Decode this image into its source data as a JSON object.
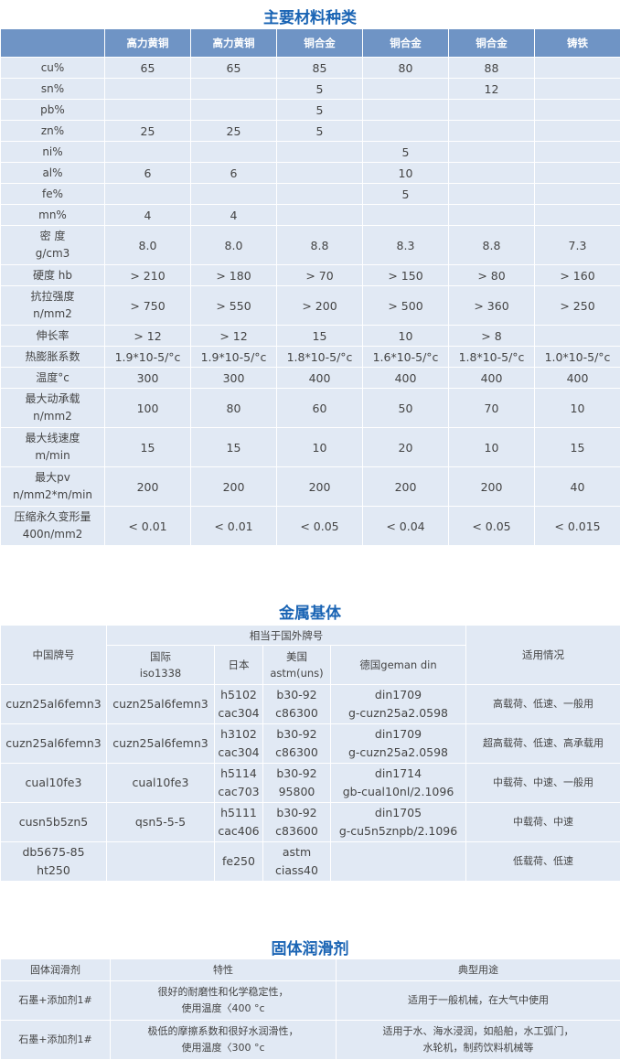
{
  "section1": {
    "title": "主要材料种类",
    "columns": [
      "",
      "高力黄铜",
      "高力黄铜",
      "铜合金",
      "铜合金",
      "铜合金",
      "铸铁"
    ],
    "rows": [
      {
        "label": [
          "cu%"
        ],
        "values": [
          "65",
          "65",
          "85",
          "80",
          "88",
          ""
        ]
      },
      {
        "label": [
          "sn%"
        ],
        "values": [
          "",
          "",
          "5",
          "",
          "12",
          ""
        ]
      },
      {
        "label": [
          "pb%"
        ],
        "values": [
          "",
          "",
          "5",
          "",
          "",
          ""
        ]
      },
      {
        "label": [
          "zn%"
        ],
        "values": [
          "25",
          "25",
          "5",
          "",
          "",
          ""
        ]
      },
      {
        "label": [
          "ni%"
        ],
        "values": [
          "",
          "",
          "",
          "5",
          "",
          ""
        ]
      },
      {
        "label": [
          "al%"
        ],
        "values": [
          "6",
          "6",
          "",
          "10",
          "",
          ""
        ]
      },
      {
        "label": [
          "fe%"
        ],
        "values": [
          "",
          "",
          "",
          "5",
          "",
          ""
        ]
      },
      {
        "label": [
          "mn%"
        ],
        "values": [
          "4",
          "4",
          "",
          "",
          "",
          ""
        ]
      },
      {
        "label": [
          "密 度",
          "g/cm3"
        ],
        "values": [
          "8.0",
          "8.0",
          "8.8",
          "8.3",
          "8.8",
          "7.3"
        ]
      },
      {
        "label": [
          "硬度 hb"
        ],
        "values": [
          "> 210",
          "> 180",
          "> 70",
          "> 150",
          "> 80",
          "> 160"
        ]
      },
      {
        "label": [
          "抗拉强度",
          "n/mm2"
        ],
        "values": [
          "> 750",
          "> 550",
          "> 200",
          "> 500",
          "> 360",
          "> 250"
        ]
      },
      {
        "label": [
          "伸长率"
        ],
        "values": [
          "> 12",
          "> 12",
          "15",
          "10",
          "> 8",
          ""
        ]
      },
      {
        "label": [
          "热膨胀系数"
        ],
        "values": [
          "1.9*10-5/°c",
          "1.9*10-5/°c",
          "1.8*10-5/°c",
          "1.6*10-5/°c",
          "1.8*10-5/°c",
          "1.0*10-5/°c"
        ]
      },
      {
        "label": [
          "温度°c"
        ],
        "values": [
          "300",
          "300",
          "400",
          "400",
          "400",
          "400"
        ]
      },
      {
        "label": [
          "最大动承载",
          "n/mm2"
        ],
        "values": [
          "100",
          "80",
          "60",
          "50",
          "70",
          "10"
        ]
      },
      {
        "label": [
          "最大线速度",
          "m/min"
        ],
        "values": [
          "15",
          "15",
          "10",
          "20",
          "10",
          "15"
        ]
      },
      {
        "label": [
          "最大pv",
          "n/mm2*m/min"
        ],
        "values": [
          "200",
          "200",
          "200",
          "200",
          "200",
          "40"
        ]
      },
      {
        "label": [
          "压缩永久变形量",
          "400n/mm2"
        ],
        "values": [
          "< 0.01",
          "< 0.01",
          "< 0.05",
          "< 0.04",
          "< 0.05",
          "< 0.015"
        ]
      }
    ]
  },
  "section2": {
    "title": "金属基体",
    "header": {
      "china": "中国牌号",
      "foreign": "相当于国外牌号",
      "usage": "适用情况",
      "intl": [
        "国际",
        "iso1338"
      ],
      "japan": [
        "日本"
      ],
      "usa": [
        "美国",
        "astm(uns)"
      ],
      "germany": [
        "德国geman din"
      ]
    },
    "rows": [
      {
        "china": [
          "cuzn25al6femn3"
        ],
        "intl": [
          "cuzn25al6femn3"
        ],
        "japan": [
          "h5102",
          "cac304"
        ],
        "usa": [
          "b30-92",
          "c86300"
        ],
        "germany": [
          "din1709",
          "g-cuzn25a2.0598"
        ],
        "usage": [
          "高载荷、低速、一般用"
        ]
      },
      {
        "china": [
          "cuzn25al6femn3"
        ],
        "intl": [
          "cuzn25al6femn3"
        ],
        "japan": [
          "h3102",
          "cac304"
        ],
        "usa": [
          "b30-92",
          "c86300"
        ],
        "germany": [
          "din1709",
          "g-cuzn25a2.0598"
        ],
        "usage": [
          "超高载荷、低速、高承载用"
        ]
      },
      {
        "china": [
          "cual10fe3"
        ],
        "intl": [
          "cual10fe3"
        ],
        "japan": [
          "h5114",
          "cac703"
        ],
        "usa": [
          "b30-92",
          "95800"
        ],
        "germany": [
          "din1714",
          "gb-cual10nl/2.1096"
        ],
        "usage": [
          "中载荷、中速、一般用"
        ]
      },
      {
        "china": [
          "cusn5b5zn5"
        ],
        "intl": [
          "qsn5-5-5"
        ],
        "japan": [
          "h5111",
          "cac406"
        ],
        "usa": [
          "b30-92",
          "c83600"
        ],
        "germany": [
          "din1705",
          "g-cu5n5znpb/2.1096"
        ],
        "usage": [
          "中载荷、中速"
        ]
      },
      {
        "china": [
          "db5675-85",
          "ht250"
        ],
        "intl": [
          ""
        ],
        "japan": [
          "fe250"
        ],
        "usa": [
          "astm",
          "ciass40"
        ],
        "germany": [
          ""
        ],
        "usage": [
          "低载荷、低速"
        ]
      }
    ]
  },
  "section3": {
    "title": "固体润滑剂",
    "header": [
      "固体润滑剂",
      "特性",
      "典型用途"
    ],
    "rows": [
      {
        "lubricant": [
          "石墨+添加剂1#"
        ],
        "property": [
          "很好的耐磨性和化学稳定性，",
          "使用温度〈400 °c"
        ],
        "usage": [
          "适用于一般机械，在大气中使用"
        ]
      },
      {
        "lubricant": [
          "石墨+添加剂1#"
        ],
        "property": [
          "极低的摩擦系数和很好水润滑性，",
          "使用温度〈300 °c"
        ],
        "usage": [
          "适用于水、海水浸润，如船舶，水工弧门，",
          "水轮机，制药饮料机械等"
        ]
      }
    ]
  }
}
